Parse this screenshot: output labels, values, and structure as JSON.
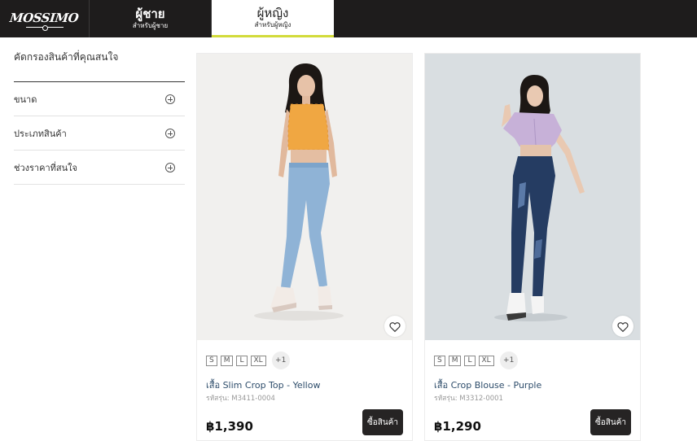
{
  "nav": {
    "logo_text": "MOSSIMO",
    "men": {
      "title": "ผู้ชาย",
      "subtitle": "สำหรับผู้ชาย"
    },
    "women": {
      "title": "ผู้หญิง",
      "subtitle": "สำหรับผู้หญิง"
    },
    "active_tab": "women",
    "accent_color": "#d2db3a"
  },
  "sidebar": {
    "title": "คัดกรองสินค้าที่คุณสนใจ",
    "filters": [
      {
        "label": "ขนาด",
        "icon": "plus-circle-icon"
      },
      {
        "label": "ประเภทสินค้า",
        "icon": "plus-circle-icon"
      },
      {
        "label": "ช่วงราคาที่สนใจ",
        "icon": "plus-circle-icon"
      }
    ]
  },
  "products": [
    {
      "name": "เสื้อ Slim Crop Top - Yellow",
      "sku": "รหัสรุ่น: M3411-0004",
      "price": "฿1,390",
      "sizes": [
        "S",
        "M",
        "L",
        "XL"
      ],
      "more_sizes": "+1",
      "buy_label": "ซื้อสินค้า",
      "image_alt": "model-yellow-crop-top"
    },
    {
      "name": "เสื้อ Crop Blouse - Purple",
      "sku": "รหัสรุ่น: M3312-0001",
      "price": "฿1,290",
      "sizes": [
        "S",
        "M",
        "L",
        "XL"
      ],
      "more_sizes": "+1",
      "buy_label": "ซื้อสินค้า",
      "image_alt": "model-purple-crop-blouse"
    }
  ]
}
